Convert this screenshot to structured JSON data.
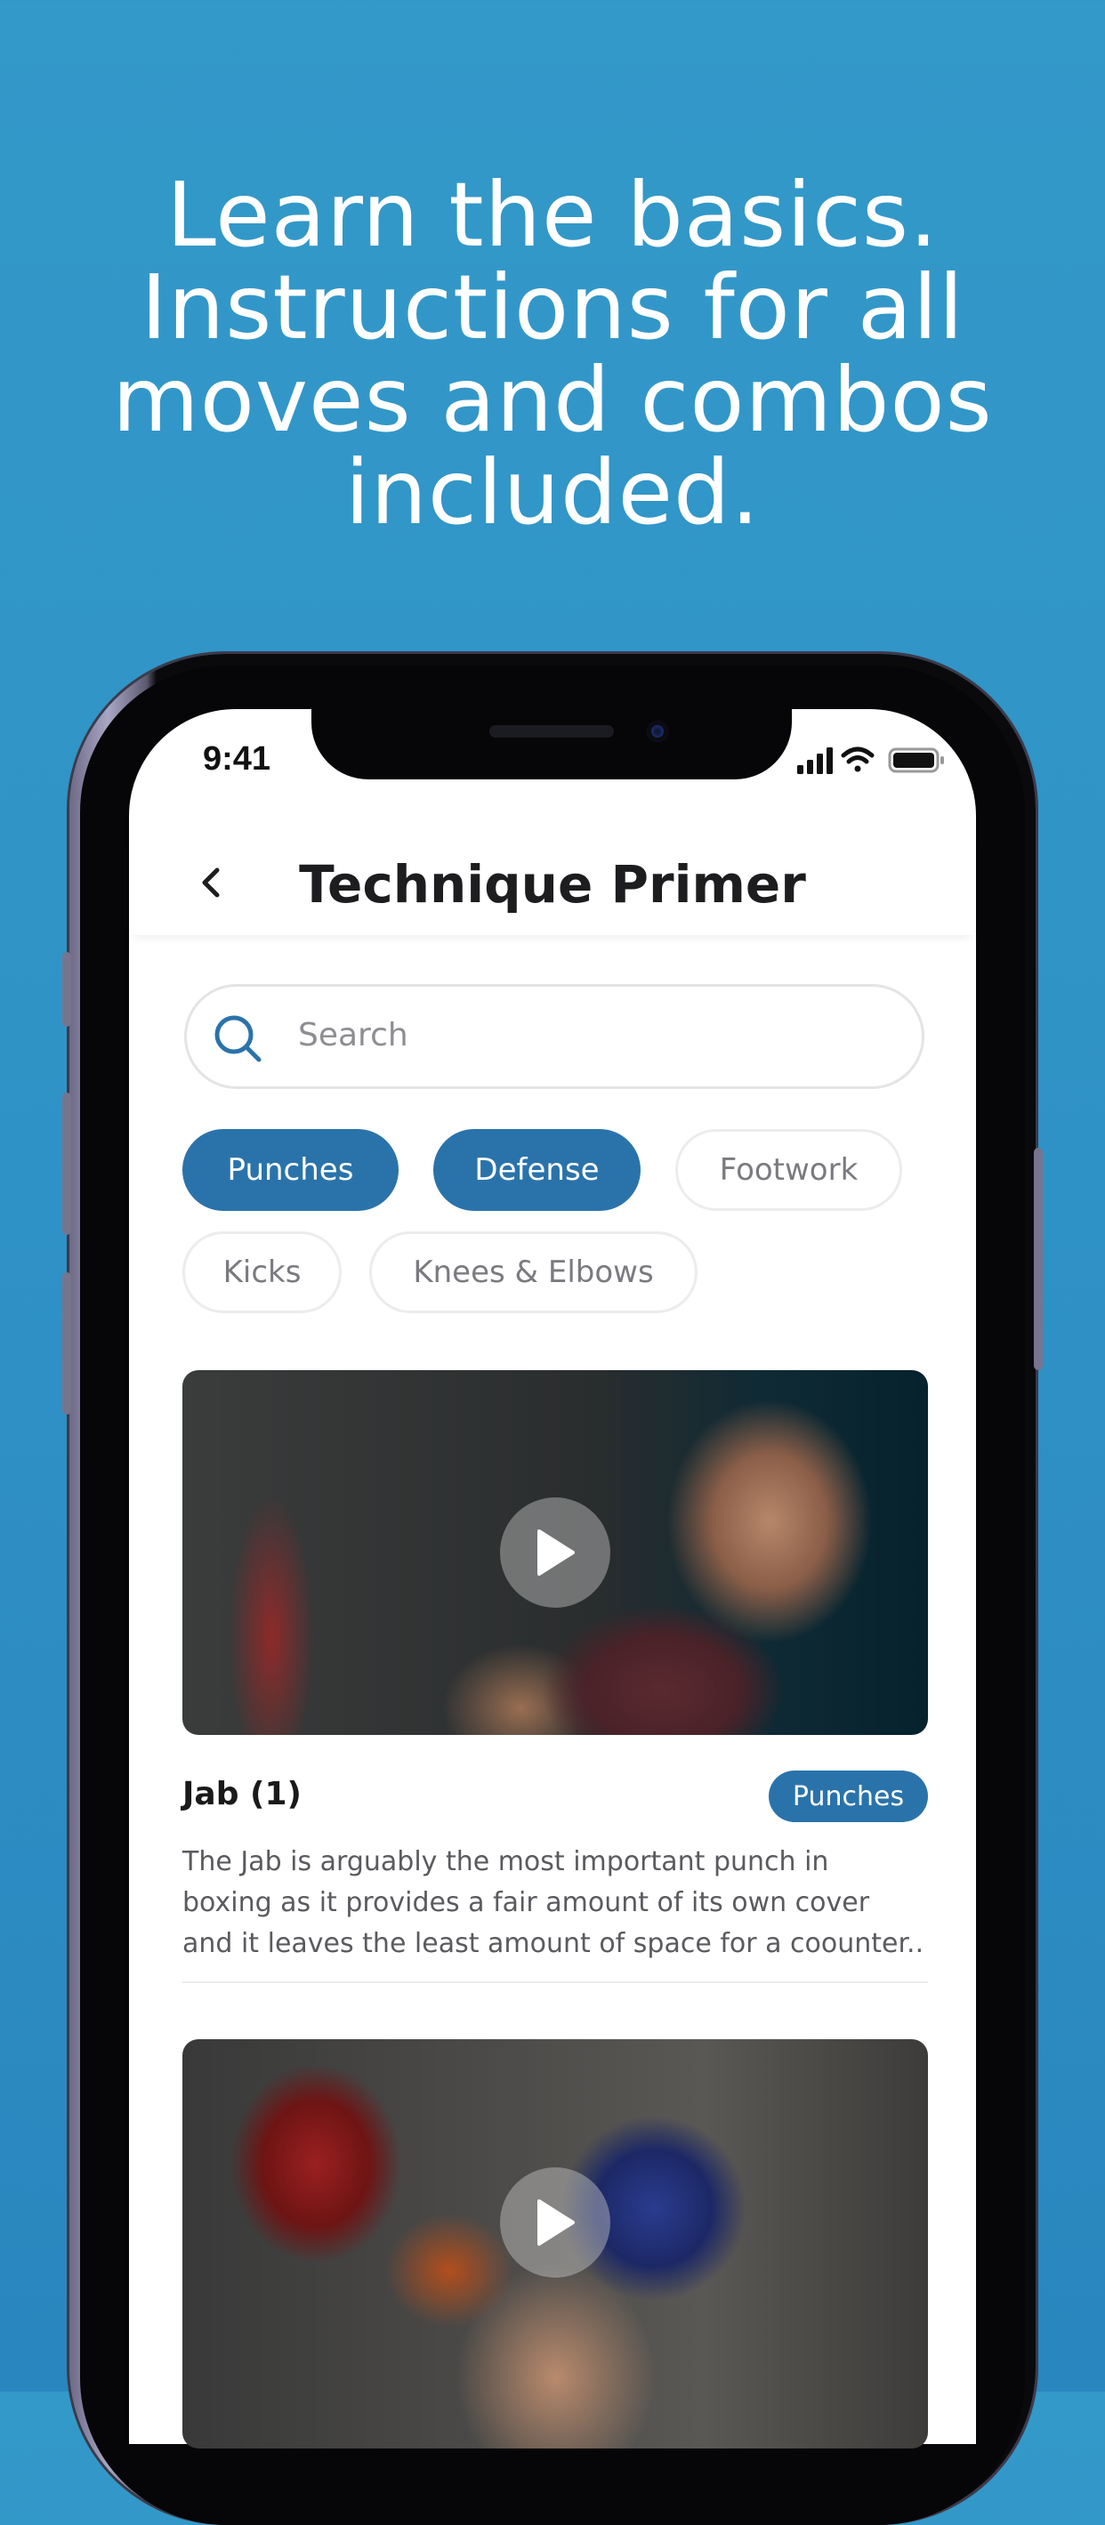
{
  "headline": {
    "lines": [
      "Learn the basics.",
      "Instructions for all",
      "moves and combos",
      "included."
    ]
  },
  "status_bar": {
    "time": "9:41"
  },
  "header": {
    "title": "Technique Primer",
    "back_icon": "chevron-left-icon"
  },
  "search": {
    "placeholder": "Search",
    "icon": "search-icon"
  },
  "filters": [
    {
      "label": "Punches",
      "selected": true
    },
    {
      "label": "Defense",
      "selected": true
    },
    {
      "label": "Footwork",
      "selected": false
    },
    {
      "label": "Kicks",
      "selected": false
    },
    {
      "label": "Knees & Elbows",
      "selected": false
    }
  ],
  "cards": [
    {
      "title": "Jab (1)",
      "tag": "Punches",
      "description_lines": [
        "The Jab is arguably the most important punch in",
        "boxing as it provides a fair amount of its own cover",
        "and it leaves the least amount of space for a coounter.."
      ],
      "play_icon": "play-icon"
    },
    {
      "play_icon": "play-icon"
    }
  ],
  "colors": {
    "background": "#3399c9",
    "accent": "#2a73aa",
    "chip_border": "#ececee"
  }
}
